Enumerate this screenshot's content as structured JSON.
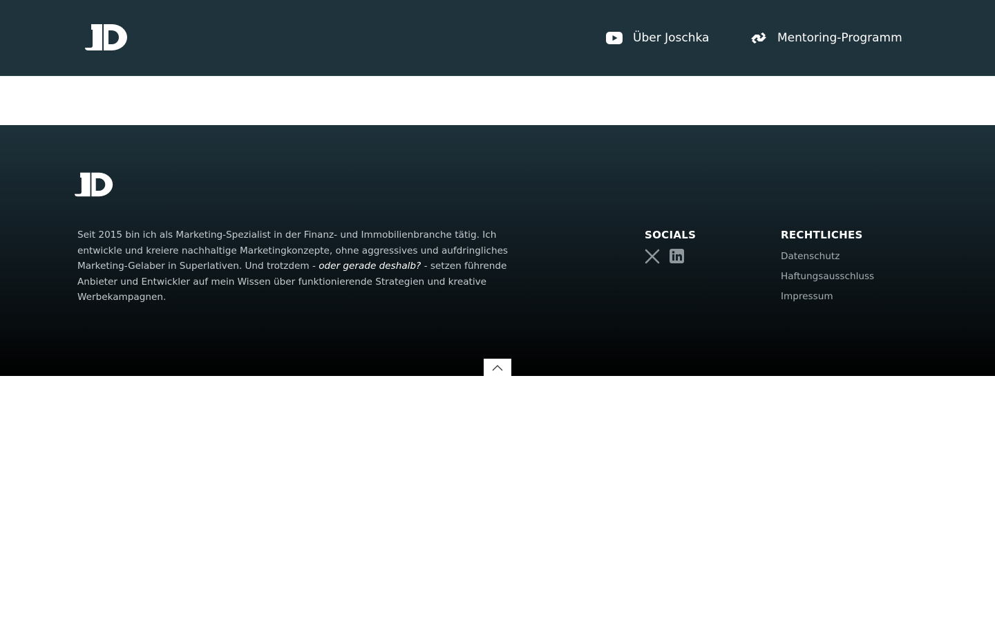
{
  "header": {
    "nav": [
      {
        "label": "Über Joschka",
        "icon": "youtube-icon"
      },
      {
        "label": "Mentoring-Programm",
        "icon": "handshake-icon"
      }
    ]
  },
  "footer": {
    "about_part1": "Seit 2015 bin ich als Marketing-Spezialist in der Finanz- und Immobilienbranche tätig. Ich entwickle und kreiere nachhaltige Marketingkonzepte, ohne aggressives und aufdringliches Marketing-Gelaber in Superlativen. Und trotzdem - ",
    "about_emphasis": "oder gerade deshalb?",
    "about_part2": " - setzen führende Anbieter und Entwickler auf mein Wissen über funktionierende Strategien und kreative Werbekampagnen.",
    "socials_heading": "SOCIALS",
    "socials": [
      "x-icon",
      "linkedin-icon"
    ],
    "legal_heading": "RECHTLICHES",
    "legal_links": [
      "Datenschutz",
      "Haftungsausschluss",
      "Impressum"
    ],
    "back_to_top_icon": "chevron-up-icon"
  },
  "colors": {
    "header_bg": "#1f333c",
    "footer_gradient_top": "#1e323b",
    "footer_gradient_bottom": "#000000",
    "text_muted": "#c4ccd0",
    "link_muted": "#a6b0b4"
  }
}
